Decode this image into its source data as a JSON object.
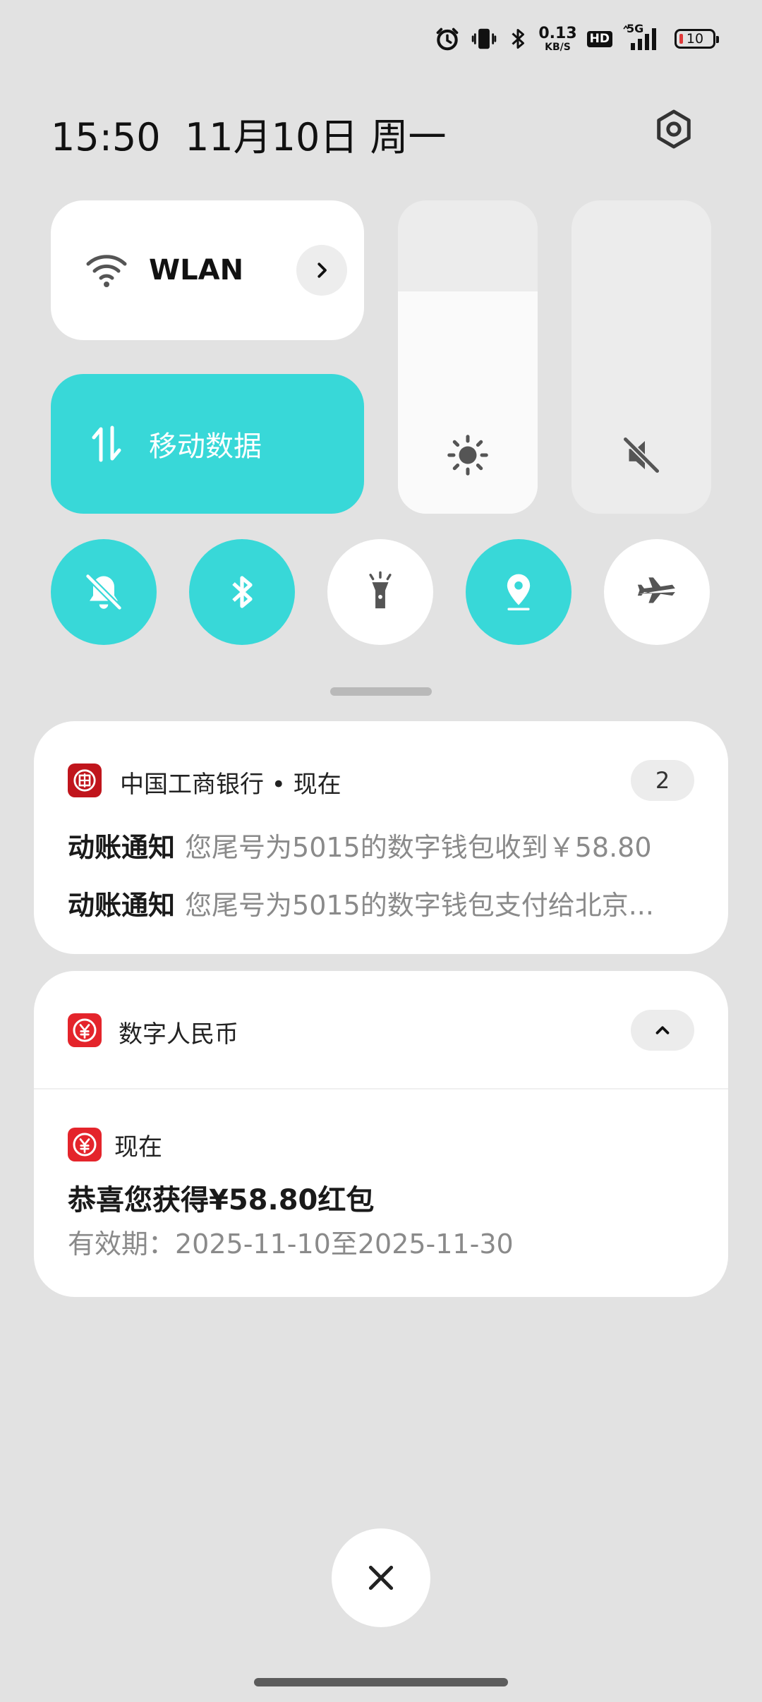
{
  "status_bar": {
    "icons": [
      "alarm-icon",
      "vibrate-icon",
      "bluetooth-icon",
      "hd-icon",
      "5g-signal-icon",
      "battery-icon"
    ],
    "net_speed_value": "0.13",
    "net_speed_unit": "KB/S",
    "hd_label": "HD",
    "network_label": "5G",
    "battery_level": "10",
    "battery_color": "#e03a3a"
  },
  "header": {
    "datetime": "15:50  11月10日 周一",
    "settings_icon": "hexagon-gear-icon"
  },
  "tiles": {
    "wlan": {
      "label": "WLAN",
      "icon": "wifi-icon",
      "active": false
    },
    "mobile_data": {
      "label": "移动数据",
      "icon": "up-down-arrows-icon",
      "active": true
    }
  },
  "sliders": {
    "brightness": {
      "icon": "sun-icon",
      "level": 0.71
    },
    "volume": {
      "icon": "speaker-muted-icon",
      "level": 0.0
    }
  },
  "quick_toggles": [
    {
      "name": "silent",
      "icon": "bell-off-icon",
      "active": true
    },
    {
      "name": "bluetooth",
      "icon": "bluetooth-icon",
      "active": true
    },
    {
      "name": "flashlight",
      "icon": "flashlight-icon",
      "active": false
    },
    {
      "name": "location",
      "icon": "location-pin-icon",
      "active": true
    },
    {
      "name": "airplane",
      "icon": "airplane-icon",
      "active": false
    }
  ],
  "colors": {
    "accent": "#38d8d8",
    "background": "#e2e2e2",
    "icbc_red": "#c0151c",
    "ecny_red": "#e4242b"
  },
  "notifications": {
    "icbc": {
      "app_label": "中国工商银行 • 现在",
      "count": "2",
      "items": [
        {
          "title": "动账通知",
          "body": "您尾号为5015的数字钱包收到￥58.80"
        },
        {
          "title": "动账通知",
          "body": "您尾号为5015的数字钱包支付给北京..."
        }
      ]
    },
    "ecny": {
      "app_label": "数字人民币",
      "sub": {
        "time": "现在",
        "title": "恭喜您获得¥58.80红包",
        "body": "有效期：2025-11-10至2025-11-30"
      }
    }
  }
}
